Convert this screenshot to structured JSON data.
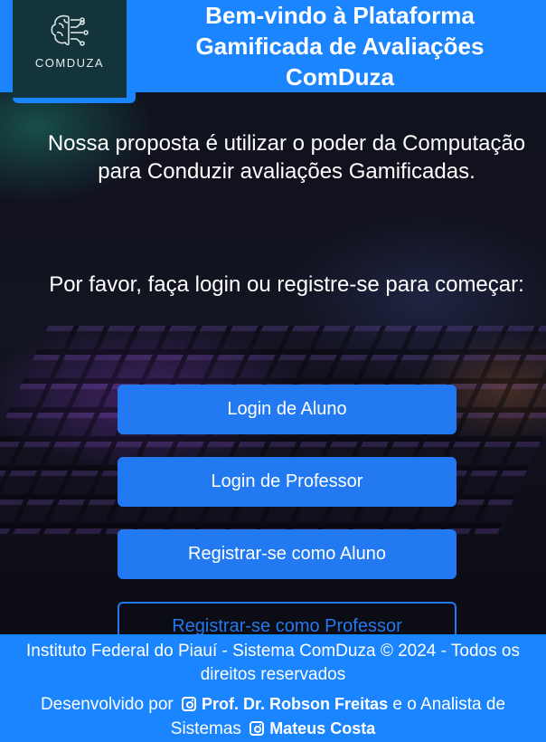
{
  "header": {
    "logo_text": "COMDUZA",
    "title": "Bem-vindo à Plataforma Gamificada de Avaliações ComDuza"
  },
  "main": {
    "intro": "Nossa proposta é utilizar o poder da Computação para Conduzir avaliações Gamificadas.",
    "prompt": "Por favor, faça login ou registre-se para começar:",
    "buttons": {
      "student_login": "Login de Aluno",
      "teacher_login": "Login de Professor",
      "student_register": "Registrar-se como Aluno",
      "teacher_register": "Registrar-se como Professor"
    }
  },
  "footer": {
    "copyright": "Instituto Federal do Piauí - Sistema ComDuza © 2024 - Todos os direitos reservados",
    "dev_prefix": "Desenvolvido por",
    "dev1": "Prof. Dr. Robson Freitas",
    "connector": "e o Analista de Sistemas",
    "dev2": "Mateus Costa"
  },
  "icons": {
    "logo": "brain-circuit-icon",
    "social": "instagram-icon"
  },
  "colors": {
    "primary": "#1a85ff",
    "button": "#2279f2",
    "logo_bg": "#12343a"
  }
}
